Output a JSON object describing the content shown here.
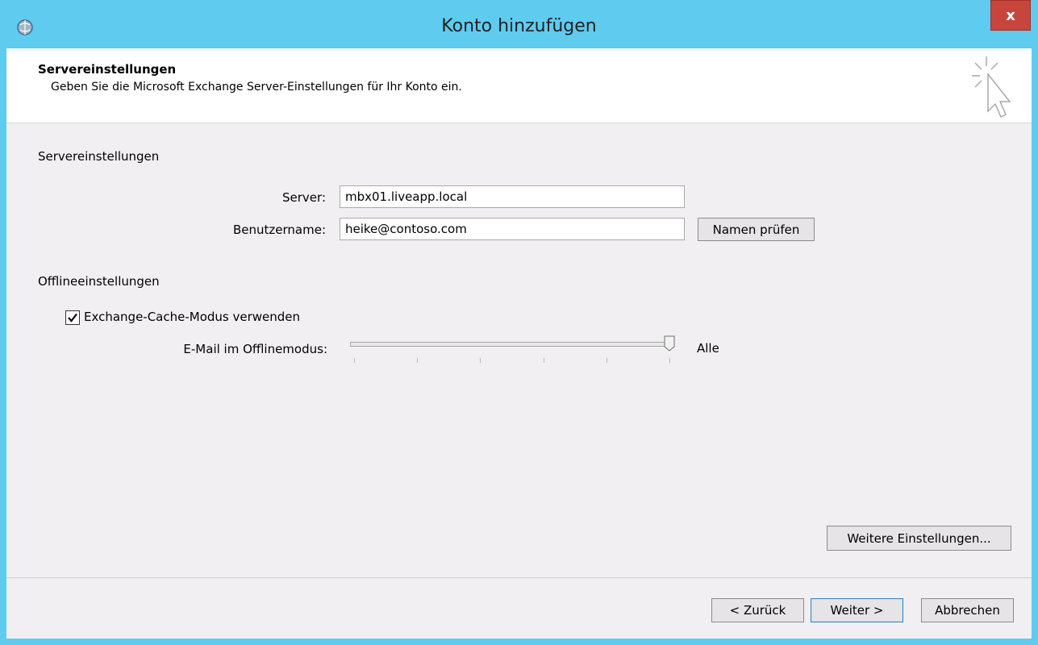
{
  "window": {
    "title": "Konto hinzufügen",
    "close_label": "x",
    "colors": {
      "frame": "#5fcbef",
      "close": "#c7453c",
      "client": "#f2eff3"
    }
  },
  "header": {
    "title": "Servereinstellungen",
    "subtitle": "Geben Sie die Microsoft Exchange Server-Einstellungen für Ihr Konto ein.",
    "icon": "cursor-sparkle-icon"
  },
  "server_section": {
    "heading": "Servereinstellungen",
    "server_label": "Server:",
    "server_value": "mbx01.liveapp.local",
    "username_label": "Benutzername:",
    "username_value": "heike@contoso.com",
    "check_names_button": "Namen prüfen"
  },
  "offline_section": {
    "heading": "Offlineeinstellungen",
    "cache_checkbox_label": "Exchange-Cache-Modus verwenden",
    "cache_checked": true,
    "mail_offline_label": "E-Mail im Offlinemodus:",
    "slider_value_text": "Alle",
    "slider_level": 1.0
  },
  "more_settings_button": "Weitere Einstellungen...",
  "footer": {
    "back_button": "< Zurück",
    "next_button": "Weiter >",
    "cancel_button": "Abbrechen"
  }
}
